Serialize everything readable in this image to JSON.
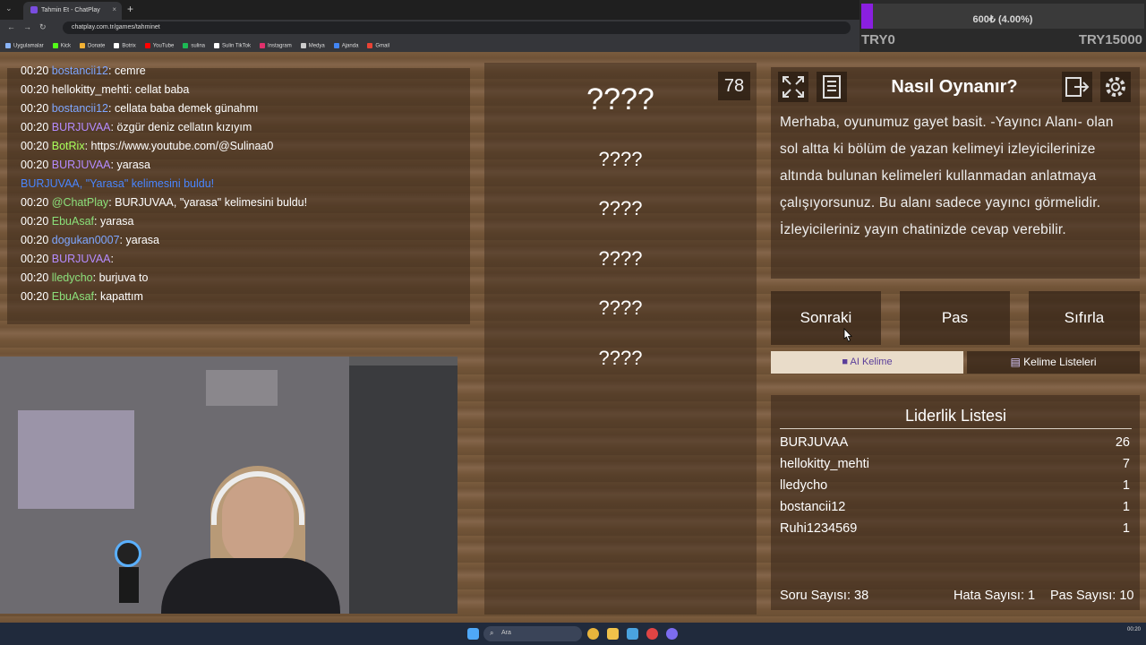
{
  "browser": {
    "tab_title": "Tahmin Et - ChatPlay",
    "tab_close": "×",
    "new_tab": "+",
    "url": "chatplay.com.tr/games/tahminet",
    "bookmarks": [
      {
        "label": "Uygulamalar",
        "color": "#8ab4f8"
      },
      {
        "label": "Kick",
        "color": "#53fc18"
      },
      {
        "label": "Donate",
        "color": "#f2b134"
      },
      {
        "label": "Botrix",
        "color": "#ffffff"
      },
      {
        "label": "YouTube",
        "color": "#ff0000"
      },
      {
        "label": "sulina",
        "color": "#1db954"
      },
      {
        "label": "Sulin TikTok",
        "color": "#ffffff"
      },
      {
        "label": "Instagram",
        "color": "#e1306c"
      },
      {
        "label": "Medya",
        "color": "#cccccc"
      },
      {
        "label": "Ajanda",
        "color": "#4285f4"
      },
      {
        "label": "Gmail",
        "color": "#ea4335"
      }
    ]
  },
  "goal": {
    "progress_text": "600₺ (4.00%)",
    "progress_fraction": 0.04,
    "min_label": "TRY0",
    "max_label": "TRY15000",
    "fill_color": "#8a1fe0"
  },
  "chat": {
    "messages": [
      {
        "time": "00:20",
        "user": "bostancii12",
        "user_color": "blue",
        "text": ": cemre"
      },
      {
        "time": "00:20",
        "user": "hellokitty_mehti",
        "user_color": "white",
        "text": ": cellat baba"
      },
      {
        "time": "00:20",
        "user": "bostancii12",
        "user_color": "blue",
        "text": ": cellata baba demek günahmı"
      },
      {
        "time": "00:20",
        "user": "BURJUVAA",
        "user_color": "purple",
        "text": ": özgür deniz cellatın kızıyım"
      },
      {
        "time": "00:20",
        "user": "BotRix",
        "user_color": "lime",
        "text": ": https://www.youtube.com/@Sulinaa0"
      },
      {
        "time": "00:20",
        "user": "BURJUVAA",
        "user_color": "purple",
        "text": ": yarasa"
      },
      {
        "notice": "BURJUVAA, \"Yarasa\" kelimesini buldu!"
      },
      {
        "time": "00:20",
        "user": "@ChatPlay",
        "user_color": "green",
        "text": ": BURJUVAA, \"yarasa\" kelimesini buldu!"
      },
      {
        "time": "00:20",
        "user": "EbuAsaf",
        "user_color": "green",
        "text": ": yarasa"
      },
      {
        "time": "00:20",
        "user": "dogukan0007",
        "user_color": "blue",
        "text": ": yarasa"
      },
      {
        "time": "00:20",
        "user": "BURJUVAA",
        "user_color": "purple",
        "text": ": "
      },
      {
        "time": "00:20",
        "user": "lledycho",
        "user_color": "green",
        "text": ": burjuva to"
      },
      {
        "time": "00:20",
        "user": "EbuAsaf",
        "user_color": "green",
        "text": ": kapattım"
      }
    ]
  },
  "game": {
    "counter": "78",
    "main_word": "????",
    "words": [
      "????",
      "????",
      "????",
      "????",
      "????"
    ]
  },
  "info": {
    "title": "Nasıl Oynanır?",
    "text": "Merhaba, oyunumuz gayet basit. -Yayıncı Alanı- olan sol altta ki bölüm de yazan kelimeyi izleyicilerinize altında bulunan kelimeleri kullanmadan anlatmaya çalışıyorsunuz. Bu alanı sadece yayıncı görmelidir. İzleyicileriniz yayın chatinizde cevap verebilir.",
    "icons": [
      "fullscreen-icon",
      "notes-icon",
      "logout-icon",
      "gear-icon"
    ]
  },
  "buttons": {
    "next": "Sonraki",
    "pass": "Pas",
    "reset": "Sıfırla",
    "ai_word": "AI Kelime",
    "word_lists": "Kelime Listeleri"
  },
  "leaderboard": {
    "title": "Liderlik Listesi",
    "rows": [
      {
        "name": "BURJUVAA",
        "score": "26"
      },
      {
        "name": "hellokitty_mehti",
        "score": "7"
      },
      {
        "name": "lledycho",
        "score": "1"
      },
      {
        "name": "bostancii12",
        "score": "1"
      },
      {
        "name": "Ruhi1234569",
        "score": "1"
      }
    ],
    "question_count": "Soru Sayısı: 38",
    "error_count": "Hata Sayısı: 1",
    "pass_count": "Pas Sayısı: 10"
  },
  "taskbar": {
    "search_placeholder": "Ara",
    "clock_time": "00:20"
  }
}
